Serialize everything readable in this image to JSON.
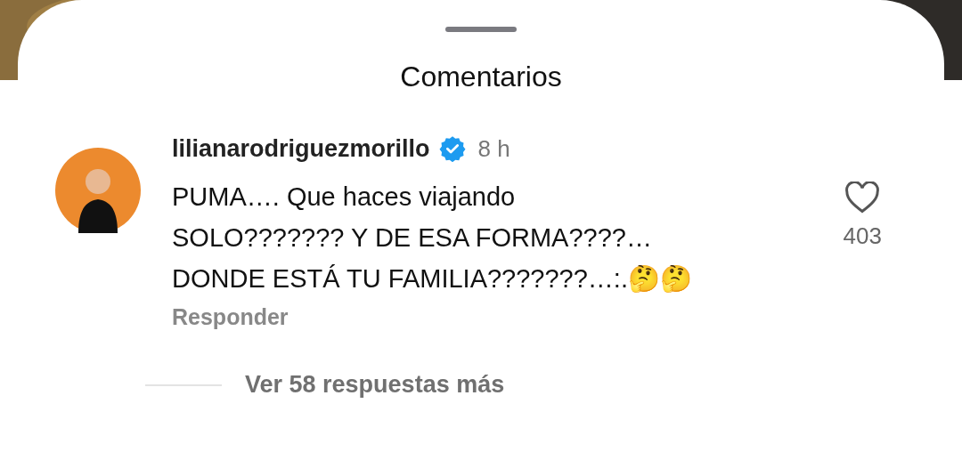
{
  "sheet": {
    "title": "Comentarios"
  },
  "comment": {
    "username": "lilianarodriguezmorillo",
    "verified": true,
    "time": "8 h",
    "text": "PUMA…. Que haces viajando\nSOLO??????? Y DE ESA FORMA????…\nDONDE ESTÁ TU FAMILIA???????…:.🤔🤔",
    "reply": "Responder",
    "liked": false,
    "likes": "403"
  },
  "view_replies": "Ver 58 respuestas más"
}
